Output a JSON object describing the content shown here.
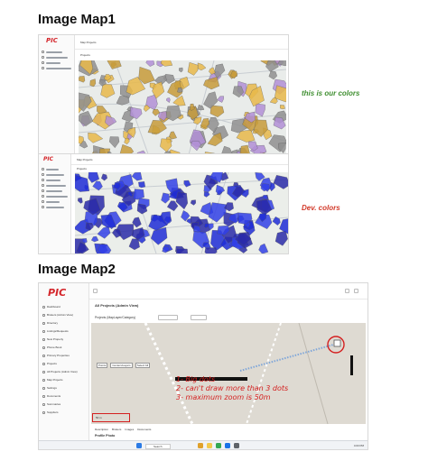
{
  "section1": {
    "heading": "Image Map1",
    "shot_a": {
      "logo": "PIC",
      "tab_label": "Map Projects",
      "breadcrumb": "Projects",
      "note": "this is our colors",
      "note_color": "#3e8e2f",
      "parcel_colors": [
        "#e8b94a",
        "#c79b3a",
        "#b28fd6",
        "#8f8f8f"
      ]
    },
    "shot_b": {
      "logo": "PIC",
      "tab_label": "Map Projects",
      "breadcrumb": "Projects",
      "note": "Dev. colors",
      "note_color": "#d23a2a",
      "parcel_colors": [
        "#1f2bd6",
        "#3140e6",
        "#2a2aa8"
      ]
    }
  },
  "section2": {
    "heading": "Image Map2",
    "shot": {
      "logo": "PIC",
      "admin_title": "All Projects (Admin View)",
      "breadcrumb": "Projects (MapLayer/Category)",
      "sidebar": {
        "items": [
          "Dashboard",
          "Brokers (Admin View)",
          "Directory",
          "Listings/Requests",
          "New Property",
          "Phone Book",
          "Primary Properties",
          "Projects",
          "All Projects (Admin View)",
          "Map Projects",
          "Settings",
          "Documents",
          "Summaries",
          "Suppliers"
        ]
      },
      "map_toolbar": [
        "Points",
        "Centers/Layers",
        "Select All"
      ],
      "annotation_lines": [
        "1- Big dots",
        "2- can't draw more than 3 dots",
        "3- maximum zoom is 50m"
      ],
      "annotation_color": "#d41f1f",
      "scale_text": "50 m",
      "bottom_tabs": [
        "Description",
        "Brokers",
        "Images",
        "Documents"
      ],
      "bottom_title": "Profile Photo",
      "taskbar_search": "Search",
      "taskbar_time": "4:03 PM"
    }
  }
}
